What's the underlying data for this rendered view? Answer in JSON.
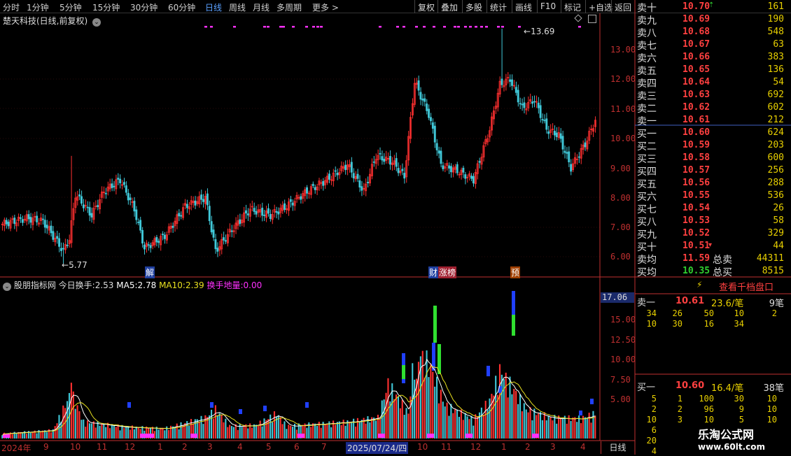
{
  "toolbar": {
    "periods": [
      "分时",
      "1分钟",
      "5分钟",
      "15分钟",
      "30分钟",
      "60分钟",
      "日线",
      "周线",
      "月线",
      "多周期",
      "更多 >"
    ],
    "active": "日线",
    "right": [
      "复权",
      "叠加",
      "多股",
      "统计",
      "画线",
      "F10",
      "标记",
      "+自选",
      "返回"
    ]
  },
  "chart_title": "楚天科技(日线,前复权)",
  "price_axis": [
    "13.00",
    "12.00",
    "11.00",
    "10.00",
    "9.00",
    "8.00",
    "7.00",
    "6.00"
  ],
  "annotations": {
    "high": "13.69",
    "low": "5.77"
  },
  "event_tags": [
    "解",
    "财",
    "涨榜",
    "预"
  ],
  "indicator": {
    "name": "股朋指标网",
    "today_label": "今日换手:",
    "today_value": "2.53",
    "ma5_label": "MA5:",
    "ma5_value": "2.78",
    "ma10_label": "MA10:",
    "ma10_value": "2.39",
    "low_label": "换手地量:",
    "low_value": "0.00",
    "axis": [
      "17.06",
      "15.00",
      "12.50",
      "10.00",
      "7.50",
      "5.00"
    ]
  },
  "date_axis": {
    "labels": [
      "2024年",
      "9",
      "10",
      "11",
      "12",
      "1",
      "2",
      "3",
      "4",
      "5",
      "6",
      "7",
      "2025/07/24/四",
      "10",
      "11",
      "12",
      "1",
      "2",
      "3",
      "4"
    ],
    "period_button": "日线"
  },
  "order_book": {
    "asks": [
      {
        "name": "卖十",
        "price": "10.70",
        "vol": "161"
      },
      {
        "name": "卖九",
        "price": "10.69",
        "vol": "190"
      },
      {
        "name": "卖八",
        "price": "10.68",
        "vol": "548"
      },
      {
        "name": "卖七",
        "price": "10.67",
        "vol": "63"
      },
      {
        "name": "卖六",
        "price": "10.66",
        "vol": "383"
      },
      {
        "name": "卖五",
        "price": "10.65",
        "vol": "136"
      },
      {
        "name": "卖四",
        "price": "10.64",
        "vol": "54"
      },
      {
        "name": "卖三",
        "price": "10.63",
        "vol": "692"
      },
      {
        "name": "卖二",
        "price": "10.62",
        "vol": "602"
      },
      {
        "name": "卖一",
        "price": "10.61",
        "vol": "212"
      }
    ],
    "bids": [
      {
        "name": "买一",
        "price": "10.60",
        "vol": "624"
      },
      {
        "name": "买二",
        "price": "10.59",
        "vol": "203"
      },
      {
        "name": "买三",
        "price": "10.58",
        "vol": "600"
      },
      {
        "name": "买四",
        "price": "10.57",
        "vol": "256"
      },
      {
        "name": "买五",
        "price": "10.56",
        "vol": "288"
      },
      {
        "name": "买六",
        "price": "10.55",
        "vol": "536"
      },
      {
        "name": "买七",
        "price": "10.54",
        "vol": "26"
      },
      {
        "name": "买八",
        "price": "10.53",
        "vol": "58"
      },
      {
        "name": "买九",
        "price": "10.52",
        "vol": "329"
      },
      {
        "name": "买十",
        "price": "10.51",
        "vol": "44"
      }
    ],
    "avg_sell_label": "卖均",
    "avg_sell": "11.59",
    "total_sell_label": "总卖",
    "total_sell": "44311",
    "avg_buy_label": "买均",
    "avg_buy": "10.35",
    "total_buy_label": "总买",
    "total_buy": "8515",
    "view_button": "查看千档盘口"
  },
  "queue": {
    "sell1": {
      "label": "卖一",
      "price": "10.61",
      "amount": "23.6/笔",
      "count": "9笔"
    },
    "sell_rows": [
      [
        "34",
        "26",
        "50",
        "10",
        "2"
      ],
      [
        "10",
        "30",
        "16",
        "34",
        ""
      ]
    ],
    "buy1": {
      "label": "买一",
      "price": "10.60",
      "amount": "16.4/笔",
      "count": "38笔"
    },
    "buy_rows": [
      [
        "5",
        "1",
        "100",
        "30",
        "10"
      ],
      [
        "2",
        "2",
        "96",
        "9",
        "10"
      ],
      [
        "10",
        "3",
        "10",
        "5",
        "10"
      ],
      [
        "6",
        "",
        "",
        "",
        ""
      ],
      [
        "20",
        "",
        "",
        "",
        ""
      ],
      [
        "4",
        "",
        "",
        "",
        ""
      ]
    ]
  },
  "watermark": {
    "name": "乐淘公式网",
    "url": "www.60lt.com"
  },
  "colors": {
    "up": "#ff3030",
    "down": "#40c8d8",
    "ma5": "#ffffff",
    "ma10": "#e8e020",
    "axis": "#c03030",
    "magenta": "#ff30ff"
  }
}
